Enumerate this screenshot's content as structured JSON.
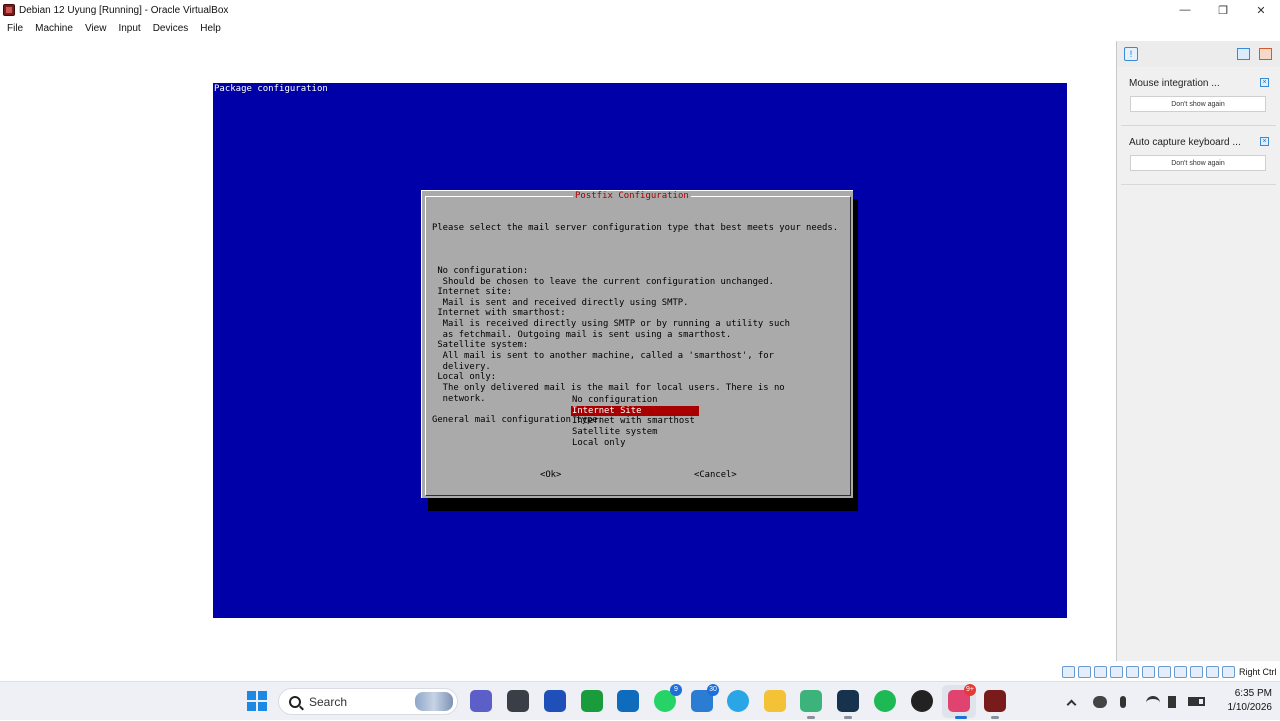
{
  "window": {
    "title": "Debian 12 Uyung [Running] - Oracle VirtualBox",
    "controls": {
      "minimize": "—",
      "restore": "❐",
      "close": "✕"
    }
  },
  "menu": [
    "File",
    "Machine",
    "View",
    "Input",
    "Devices",
    "Help"
  ],
  "vm": {
    "screen_title": "Package configuration",
    "dialog": {
      "title": "Postfix Configuration",
      "intro": "Please select the mail server configuration type that best meets your needs.",
      "body_lines": [
        "",
        " No configuration:",
        "  Should be chosen to leave the current configuration unchanged.",
        " Internet site:",
        "  Mail is sent and received directly using SMTP.",
        " Internet with smarthost:",
        "  Mail is received directly using SMTP or by running a utility such",
        "  as fetchmail. Outgoing mail is sent using a smarthost.",
        " Satellite system:",
        "  All mail is sent to another machine, called a 'smarthost', for",
        "  delivery.",
        " Local only:",
        "  The only delivered mail is the mail for local users. There is no",
        "  network.",
        "",
        "General mail configuration type:"
      ],
      "options": [
        "No configuration",
        "Internet Site",
        "Internet with smarthost",
        "Satellite system",
        "Local only"
      ],
      "selected_option": "Internet Site",
      "ok_label": "<Ok>",
      "cancel_label": "<Cancel>"
    }
  },
  "notifications": [
    {
      "title": "Mouse integration ...",
      "button": "Don't show again"
    },
    {
      "title": "Auto capture keyboard ...",
      "button": "Don't show again"
    }
  ],
  "statusbar": {
    "host_key": "Right Ctrl"
  },
  "taskbar": {
    "search_label": "Search",
    "badges": {
      "whatsapp": "9",
      "chat": "30",
      "discord": "9+"
    },
    "time": "6:35 PM",
    "date": "1/10/2026"
  }
}
